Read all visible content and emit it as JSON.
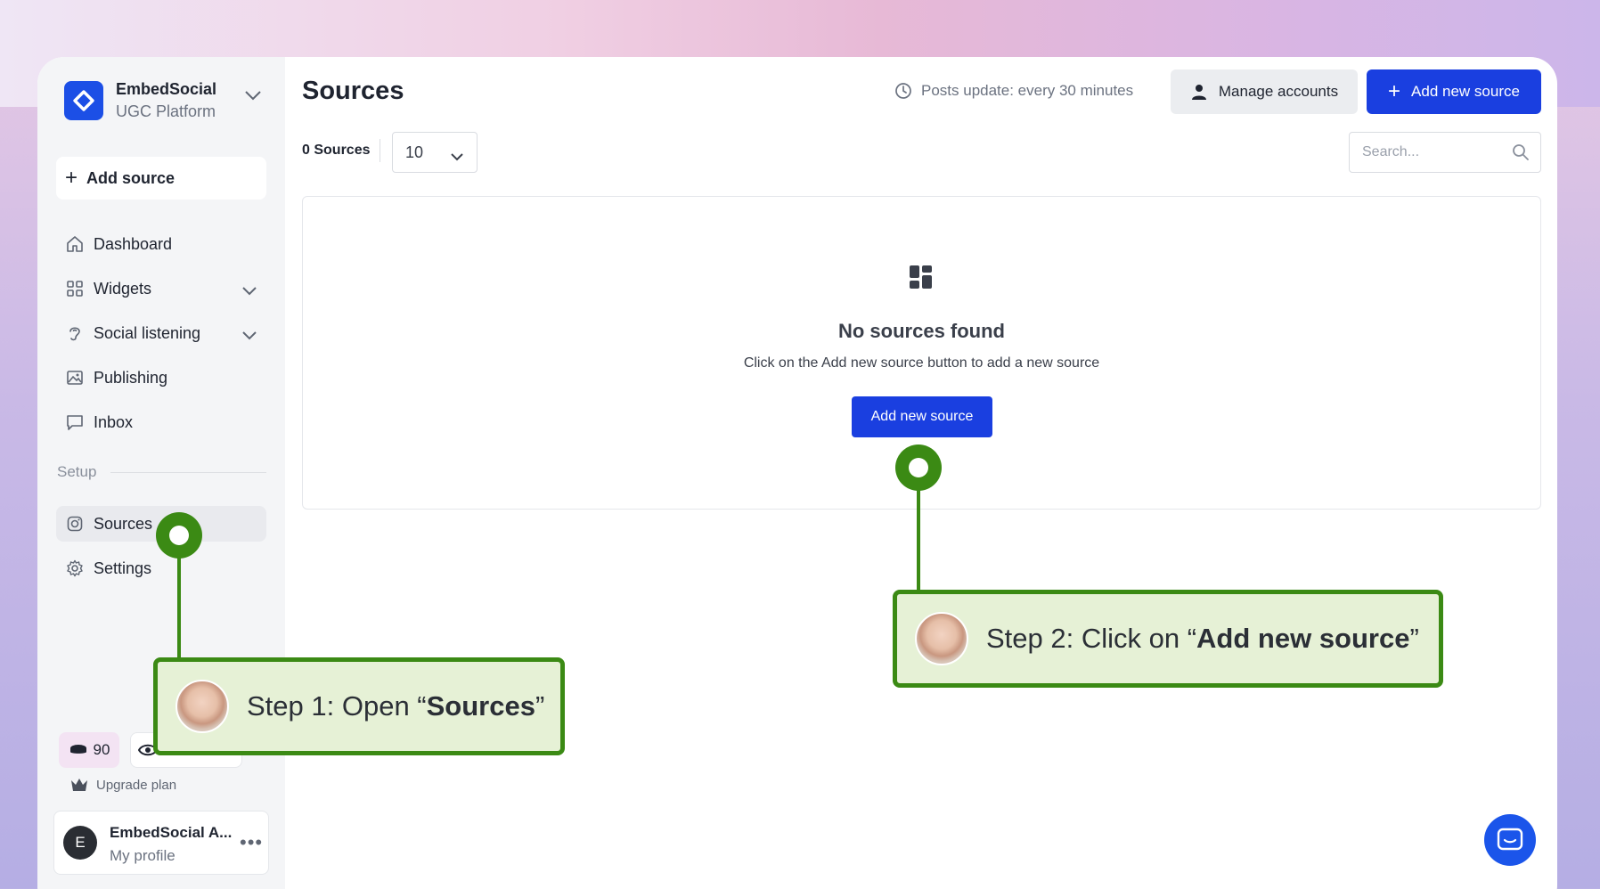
{
  "brand": {
    "name": "EmbedSocial",
    "subtitle": "UGC Platform"
  },
  "sidebar": {
    "add_source_label": "Add source",
    "items": [
      {
        "label": "Dashboard",
        "icon": "home-icon"
      },
      {
        "label": "Widgets",
        "icon": "grid-icon",
        "expandable": true
      },
      {
        "label": "Social listening",
        "icon": "ear-icon",
        "expandable": true
      },
      {
        "label": "Publishing",
        "icon": "image-icon"
      },
      {
        "label": "Inbox",
        "icon": "message-icon"
      }
    ],
    "setup_label": "Setup",
    "setup_items": [
      {
        "label": "Sources",
        "icon": "instagram-icon",
        "active": true
      },
      {
        "label": "Settings",
        "icon": "gear-icon"
      }
    ],
    "credits": "90",
    "upgrade_label": "Upgrade plan",
    "profile": {
      "initial": "E",
      "name": "EmbedSocial A...",
      "subtitle": "My profile"
    }
  },
  "header": {
    "title": "Sources",
    "posts_update": "Posts update: every 30 minutes",
    "manage_accounts_label": "Manage accounts",
    "add_new_source_label": "Add new source"
  },
  "toolbar": {
    "count_label": "0 Sources",
    "page_size": "10",
    "search_placeholder": "Search..."
  },
  "empty_state": {
    "title": "No sources found",
    "text": "Click on the Add new source button to add a new source",
    "button_label": "Add new source"
  },
  "annotations": {
    "step1": {
      "prefix": "Step 1: Open “",
      "bold": "Sources",
      "suffix": "”"
    },
    "step2": {
      "prefix": "Step 2: Click on “",
      "bold": "Add new source",
      "suffix": "”"
    }
  },
  "colors": {
    "accent": "#1a3fe0",
    "annotation_green": "#3b8a14",
    "annotation_bg": "#e6f1d6"
  }
}
